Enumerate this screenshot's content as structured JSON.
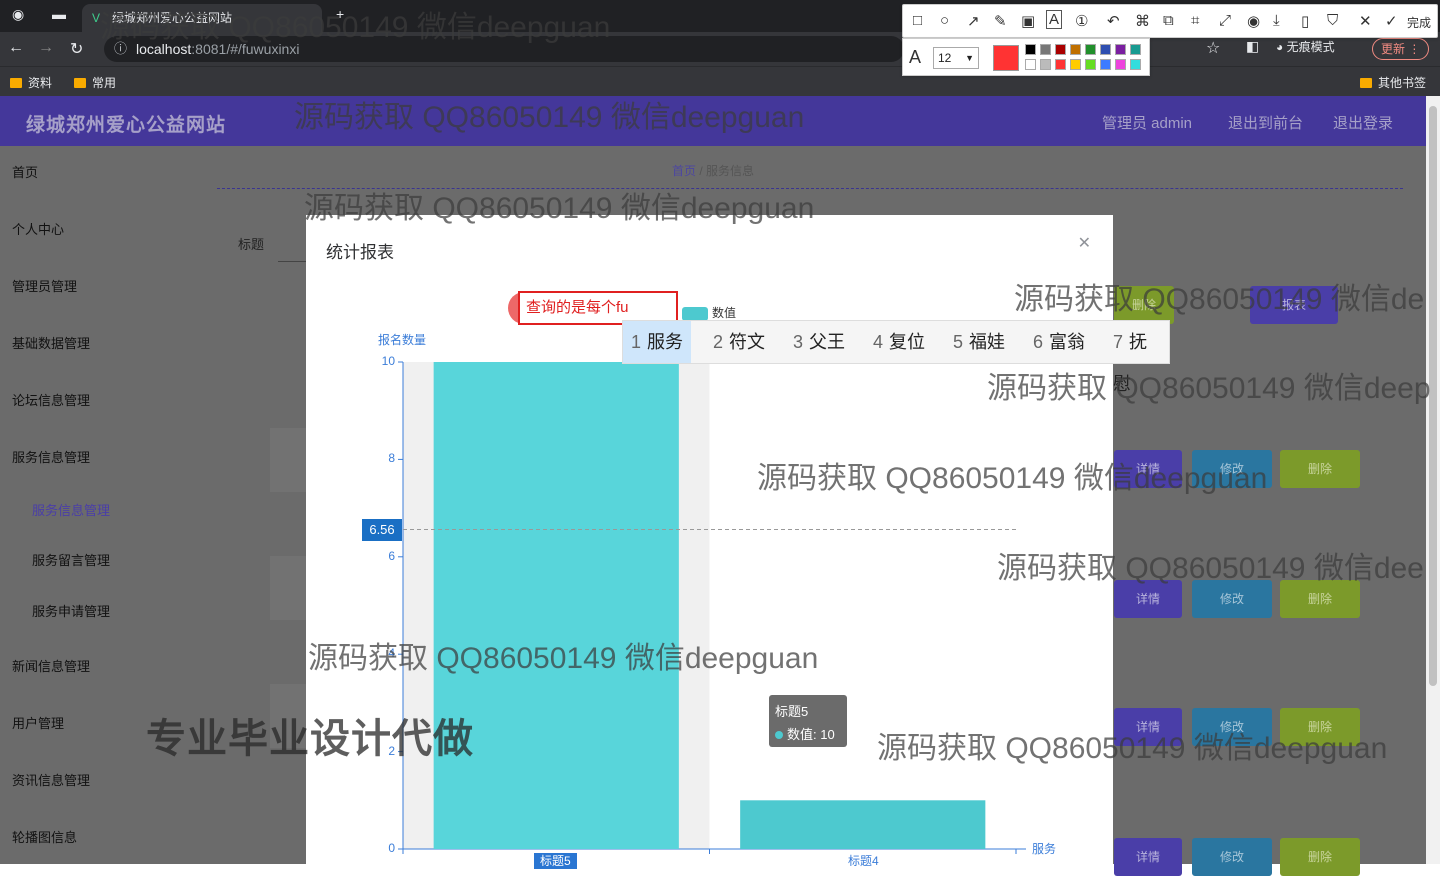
{
  "browser": {
    "tab_title": "绿城郑州爱心公益网站",
    "url_host": "localhost",
    "url_port": ":8081",
    "url_path": "/#/fuwuxinxi",
    "incognito_label": "无痕模式",
    "update_label": "更新",
    "bookmarks": [
      "资料",
      "常用"
    ],
    "other_bookmarks": "其他书签"
  },
  "annotation_tool": {
    "done_label": "完成",
    "font_size": "12",
    "current_color": "#ff3333",
    "palette": [
      "#000000",
      "#777777",
      "#aa0000",
      "#c07000",
      "#218f2c",
      "#2f4fb0",
      "#7a1fa0",
      "#199b91",
      "#ffffff",
      "#bbbbbb",
      "#ff3333",
      "#ffcc00",
      "#66dd22",
      "#3d7bff",
      "#ee44dd",
      "#33dddd"
    ]
  },
  "app": {
    "brand": "绿城郑州爱心公益网站",
    "header_links": [
      "管理员 admin",
      "退出到前台",
      "退出登录"
    ],
    "sidebar": [
      {
        "label": "首页"
      },
      {
        "label": "个人中心"
      },
      {
        "label": "管理员管理"
      },
      {
        "label": "基础数据管理"
      },
      {
        "label": "论坛信息管理"
      },
      {
        "label": "服务信息管理"
      },
      {
        "label": "服务信息管理"
      },
      {
        "label": "服务留言管理"
      },
      {
        "label": "服务申请管理"
      },
      {
        "label": "新闻信息管理"
      },
      {
        "label": "用户管理"
      },
      {
        "label": "资讯信息管理"
      },
      {
        "label": "轮播图信息"
      }
    ],
    "breadcrumb": {
      "home": "首页",
      "current": "服务信息"
    },
    "filter_label": "标题",
    "row_buttons": {
      "view": "详情",
      "edit": "修改",
      "delete": "删除"
    },
    "top_buttons": {
      "delete": "删除",
      "report": "报表"
    }
  },
  "modal": {
    "title": "统计报表",
    "annotation_text": "查询的是每个fu",
    "ime_candidates": [
      "服务",
      "符文",
      "父王",
      "复位",
      "福娃",
      "富翁",
      "抚慰"
    ],
    "tooltip": {
      "category": "标题5",
      "series": "数值",
      "value": "数值: 10"
    }
  },
  "chart_data": {
    "type": "bar",
    "title": "",
    "legend": [
      "数值"
    ],
    "ylabel": "报名数量",
    "xlabel": "服务",
    "categories": [
      "标题5",
      "标题4"
    ],
    "series": [
      {
        "name": "数值",
        "values": [
          10,
          1
        ]
      }
    ],
    "ylim": [
      0,
      10
    ],
    "yticks": [
      0,
      2,
      4,
      6,
      8,
      10
    ],
    "mark_line": {
      "label": "6.56",
      "value": 6.56
    },
    "color": "#4dc9cf",
    "highlight_category": "标题5"
  },
  "watermarks": {
    "repeated": "源码获取 QQ86050149 微信deepguan",
    "cropped_right": "源码获取 QQ86050149 微信de",
    "cropped_right_2": "源码获取 QQ86050149 微信deep",
    "cropped_right_3": "源码获取 QQ86050149 微信dee",
    "bold": "专业毕业设计代做"
  }
}
